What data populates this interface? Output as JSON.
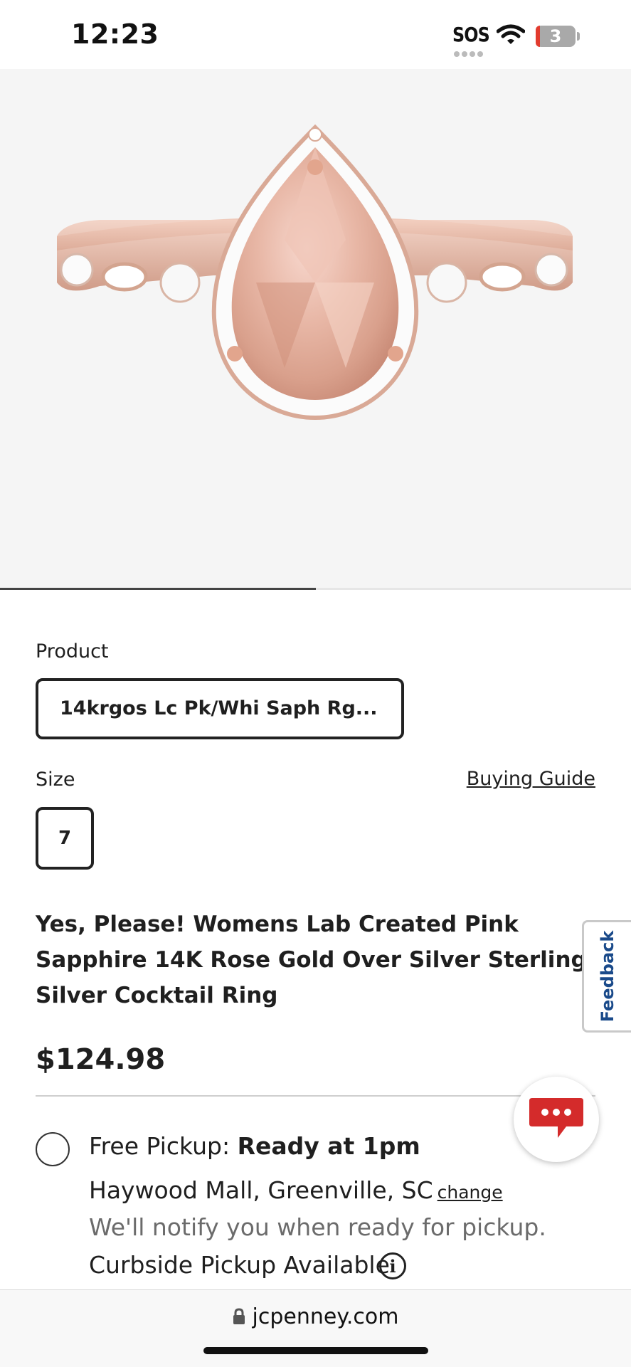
{
  "status_bar": {
    "time": "12:23",
    "sos": "SOS",
    "battery": "3",
    "icons": [
      "wifi-icon",
      "battery-icon"
    ]
  },
  "gallery": {
    "image_alt": "pear-shaped pink sapphire halo ring in rose gold",
    "current_slide_fraction": 0.5
  },
  "product": {
    "label": "Product",
    "selected": "14krgos Lc Pk/Whi Saph Rg..."
  },
  "size": {
    "label": "Size",
    "buying_guide": "Buying Guide",
    "selected": "7"
  },
  "title": "Yes, Please! Womens Lab Created Pink Sapphire 14K Rose Gold Over Silver Sterling Silver Cocktail Ring",
  "price": "$124.98",
  "pickup": {
    "prefix": "Free Pickup:",
    "ready": "Ready at 1pm",
    "store": "Haywood Mall, Greenville, SC",
    "change": "change",
    "notify": "We'll notify you when ready for pickup.",
    "curbside": "Curbside Pickup Available",
    "info_icon": "i"
  },
  "feedback": "Feedback",
  "browser": {
    "url": "jcpenney.com"
  },
  "colors": {
    "chat_red": "#d42b2b",
    "feedback_blue": "#1a4a8a",
    "gallery_bg": "#f5f5f5"
  }
}
